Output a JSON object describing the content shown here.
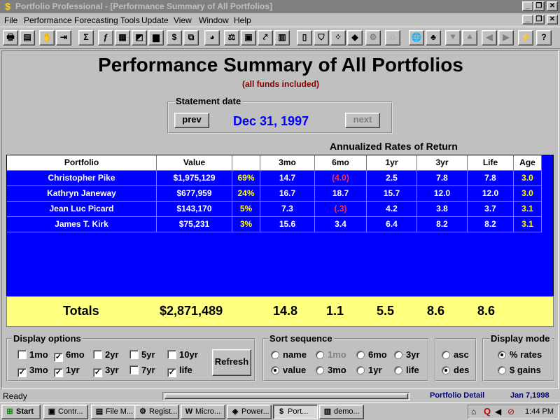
{
  "window": {
    "title": "Portfolio Professional - [Performance Summary of All Portfolios]",
    "minimize": "_",
    "restore": "❐",
    "close": "✕"
  },
  "menu": [
    "File",
    "Performance",
    "Forecasting Tools",
    "Update",
    "View",
    "Window",
    "Help"
  ],
  "toolbar": [
    {
      "icon": "printer-icon",
      "glyph": "🖶"
    },
    {
      "icon": "preview-icon",
      "glyph": "▤"
    },
    {
      "icon": "hand-icon",
      "glyph": "✋"
    },
    {
      "icon": "exit-door-icon",
      "glyph": "⇥"
    },
    {
      "icon": "sigma-icon",
      "glyph": "Σ"
    },
    {
      "icon": "function-icon",
      "glyph": "ƒ"
    },
    {
      "icon": "calculator-icon",
      "glyph": "▦"
    },
    {
      "icon": "chart-mix-icon",
      "glyph": "◩"
    },
    {
      "icon": "bar-chart-icon",
      "glyph": "▆"
    },
    {
      "icon": "money-bag-icon",
      "glyph": "$"
    },
    {
      "icon": "copy-icon",
      "glyph": "⧉"
    },
    {
      "icon": "pie-chart-icon",
      "glyph": "◕"
    },
    {
      "icon": "compare-icon",
      "glyph": "⚖"
    },
    {
      "icon": "ledger-icon",
      "glyph": "▣"
    },
    {
      "icon": "line-chart-icon",
      "glyph": "⤤"
    },
    {
      "icon": "columns-chart-icon",
      "glyph": "▥"
    },
    {
      "icon": "book-icon",
      "glyph": "▯"
    },
    {
      "icon": "shield-icon",
      "glyph": "⛉"
    },
    {
      "icon": "grid-icon",
      "glyph": "⁘"
    },
    {
      "icon": "colors-icon",
      "glyph": "◆"
    },
    {
      "icon": "gear-icon",
      "glyph": "⚙"
    },
    {
      "icon": "fade-icon",
      "glyph": "◌"
    },
    {
      "icon": "globe-icon",
      "glyph": "🌐"
    },
    {
      "icon": "tree-icon",
      "glyph": "♣"
    },
    {
      "icon": "arrow-down-icon",
      "glyph": "⯆"
    },
    {
      "icon": "arrow-up-icon",
      "glyph": "⯅"
    },
    {
      "icon": "arrow-left-icon",
      "glyph": "◀"
    },
    {
      "icon": "arrow-right-icon",
      "glyph": "▶"
    },
    {
      "icon": "lightning-icon",
      "glyph": "⚡"
    },
    {
      "icon": "help-icon",
      "glyph": "?"
    }
  ],
  "header": {
    "title": "Performance Summary of All Portfolios",
    "subtitle": "(all funds included)"
  },
  "statement": {
    "label": "Statement date",
    "prev": "prev",
    "date": "Dec 31, 1997",
    "next": "next"
  },
  "annualized_label": "Annualized Rates of Return",
  "grid": {
    "columns": [
      "Portfolio",
      "Value",
      "",
      "3mo",
      "6mo",
      "1yr",
      "3yr",
      "Life",
      "Age"
    ],
    "rows": [
      [
        "Christopher Pike",
        "$1,975,129",
        "69%",
        "14.7",
        "(4.0)",
        "2.5",
        "7.8",
        "7.8",
        "3.0"
      ],
      [
        "Kathryn Janeway",
        "$677,959",
        "24%",
        "16.7",
        "18.7",
        "15.7",
        "12.0",
        "12.0",
        "3.0"
      ],
      [
        "Jean Luc Picard",
        "$143,170",
        "5%",
        "7.3",
        "(.3)",
        "4.2",
        "3.8",
        "3.7",
        "3.1"
      ],
      [
        "James T. Kirk",
        "$75,231",
        "3%",
        "15.6",
        "3.4",
        "6.4",
        "8.2",
        "8.2",
        "3.1"
      ]
    ]
  },
  "totals": {
    "label": "Totals",
    "value": "$2,871,489",
    "m3": "14.8",
    "m6": "1.1",
    "y1": "5.5",
    "y3": "8.6",
    "life": "8.6"
  },
  "display_options": {
    "label": "Display options",
    "items": [
      {
        "label": "1mo",
        "checked": false
      },
      {
        "label": "6mo",
        "checked": true
      },
      {
        "label": "2yr",
        "checked": false
      },
      {
        "label": "5yr",
        "checked": false
      },
      {
        "label": "10yr",
        "checked": false
      },
      {
        "label": "3mo",
        "checked": true
      },
      {
        "label": "1yr",
        "checked": true
      },
      {
        "label": "3yr",
        "checked": true
      },
      {
        "label": "7yr",
        "checked": false
      },
      {
        "label": "life",
        "checked": true
      }
    ],
    "refresh": "Refresh"
  },
  "sort": {
    "label": "Sort sequence",
    "items": [
      {
        "label": "name",
        "selected": false,
        "disabled": false
      },
      {
        "label": "1mo",
        "selected": false,
        "disabled": true
      },
      {
        "label": "6mo",
        "selected": false,
        "disabled": false
      },
      {
        "label": "3yr",
        "selected": false,
        "disabled": false
      },
      {
        "label": "value",
        "selected": true,
        "disabled": false
      },
      {
        "label": "3mo",
        "selected": false,
        "disabled": false
      },
      {
        "label": "1yr",
        "selected": false,
        "disabled": false
      },
      {
        "label": "life",
        "selected": false,
        "disabled": false
      }
    ]
  },
  "order": {
    "items": [
      {
        "label": "asc",
        "selected": false
      },
      {
        "label": "des",
        "selected": true
      }
    ]
  },
  "display_mode": {
    "label": "Display mode",
    "items": [
      {
        "label": "% rates",
        "selected": true
      },
      {
        "label": "$ gains",
        "selected": false
      }
    ]
  },
  "status": {
    "ready": "Ready",
    "view": "Portfolio Detail",
    "date": "Jan 7,1998"
  },
  "taskbar": {
    "start": "Start",
    "tasks": [
      {
        "label": "Contr...",
        "icon": "control-panel-icon",
        "glyph": "▣"
      },
      {
        "label": "File M...",
        "icon": "file-manager-icon",
        "glyph": "▤"
      },
      {
        "label": "Regist...",
        "icon": "registry-icon",
        "glyph": "⚙"
      },
      {
        "label": "Micro...",
        "icon": "word-icon",
        "glyph": "W"
      },
      {
        "label": "Power...",
        "icon": "powerpoint-icon",
        "glyph": "◈"
      },
      {
        "label": "Port...",
        "icon": "portfolio-icon",
        "glyph": "$",
        "active": true
      },
      {
        "label": "demo...",
        "icon": "demo-icon",
        "glyph": "▥"
      }
    ],
    "clock": "1:44 PM"
  },
  "colors": {
    "grid_background": "#0000ff",
    "totals_background": "#ffff80",
    "statement_date": "#0000ff",
    "negative": "#ff3030",
    "percent": "#ffff00"
  }
}
